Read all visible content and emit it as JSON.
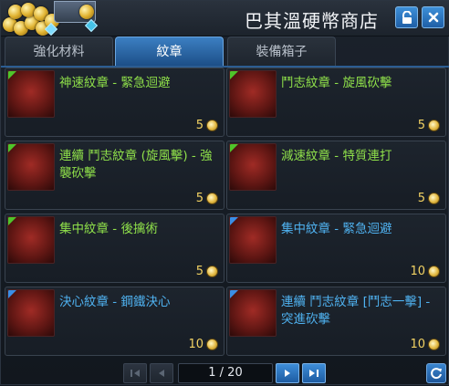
{
  "window": {
    "title": "巴其溫硬幣商店"
  },
  "icons": {
    "lock": "lock-icon",
    "close": "close-icon",
    "coin": "coin-icon",
    "first_page": "first-page-icon",
    "prev_page": "prev-page-icon",
    "next_page": "next-page-icon",
    "last_page": "last-page-icon",
    "refresh": "refresh-icon"
  },
  "tabs": [
    {
      "label": "強化材料",
      "active": false
    },
    {
      "label": "紋章",
      "active": true
    },
    {
      "label": "裝備箱子",
      "active": false
    }
  ],
  "items": [
    {
      "name": "神速紋章 - 緊急迴避",
      "price": "5",
      "rarity": "green"
    },
    {
      "name": "鬥志紋章 - 旋風砍擊",
      "price": "5",
      "rarity": "green"
    },
    {
      "name": "連續 鬥志紋章 (旋風擊) - 強襲砍擊",
      "price": "5",
      "rarity": "green"
    },
    {
      "name": "減速紋章 - 特質連打",
      "price": "5",
      "rarity": "green"
    },
    {
      "name": "集中紋章 - 後擒術",
      "price": "5",
      "rarity": "green"
    },
    {
      "name": "集中紋章 - 緊急迴避",
      "price": "10",
      "rarity": "blue"
    },
    {
      "name": "決心紋章 - 鋼鐵決心",
      "price": "10",
      "rarity": "blue"
    },
    {
      "name": "連續 鬥志紋章 [鬥志一擊] - 突進砍擊",
      "price": "10",
      "rarity": "blue"
    }
  ],
  "colors": {
    "green_item": "#8fe04a",
    "blue_item": "#4fb2f0",
    "price": "#f2d263",
    "accent": "#3c7fc2"
  },
  "pager": {
    "text": "1 / 20",
    "current": 1,
    "total": 20
  }
}
